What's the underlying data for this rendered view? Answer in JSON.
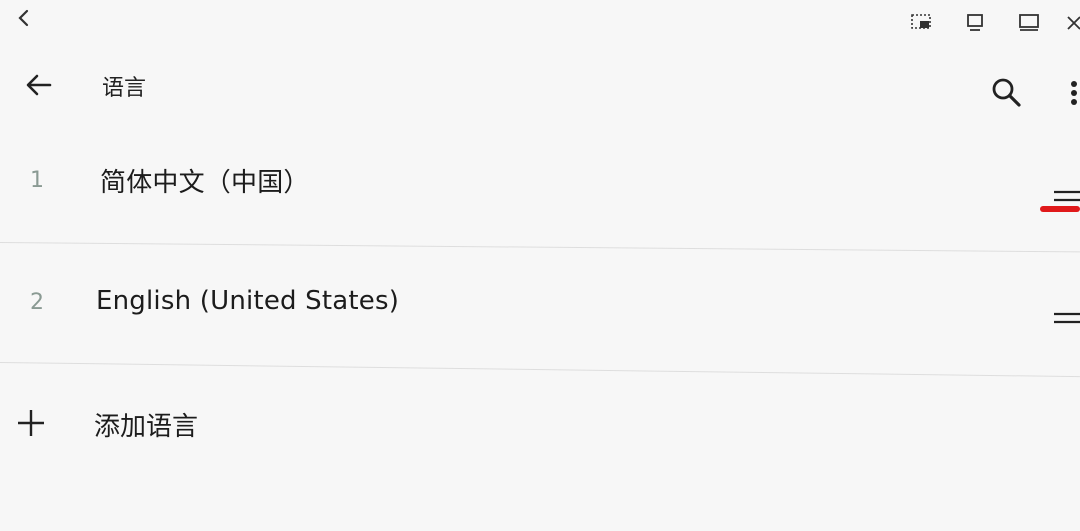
{
  "app_bar": {
    "title": "语言",
    "back_icon": "arrow-left-icon",
    "search_icon": "search-icon",
    "more_icon": "more-vert-icon"
  },
  "window_chrome": {
    "icons": [
      "chevron-left-icon",
      "screenshot-select-icon",
      "restore-window-icon",
      "maximize-window-icon",
      "close-icon"
    ]
  },
  "languages": [
    {
      "index": "1",
      "name": "简体中文（中国）"
    },
    {
      "index": "2",
      "name": "English (United States)"
    }
  ],
  "add_language": {
    "label": "添加语言"
  },
  "colors": {
    "background": "#f7f7f7",
    "annotation_underline": "#e0191a",
    "index_text": "#8a9a93"
  }
}
